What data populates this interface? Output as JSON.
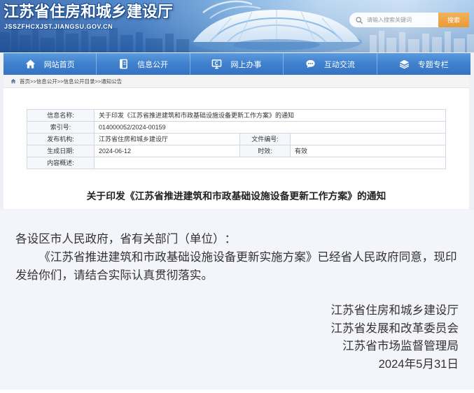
{
  "theme": {
    "brand_blue": "#3573c2",
    "brand_blue_light": "#5b9ade",
    "accent_orange": "#e99a36",
    "title_outline": "#1c4d93"
  },
  "header": {
    "site_title": "江苏省住房和城乡建设厅",
    "site_domain": "JSSZFHCXJST.JIANGSU.GOV.CN",
    "search": {
      "icon": "search-icon",
      "placeholder": "请输入搜索关键词",
      "button_label": "搜索"
    }
  },
  "nav": {
    "items": [
      {
        "label": "网站首页",
        "icon": "home-icon"
      },
      {
        "label": "信息公开",
        "icon": "notebook-icon"
      },
      {
        "label": "网上办事",
        "icon": "monitor-icon"
      },
      {
        "label": "互动交流",
        "icon": "chat-bubble-icon"
      },
      {
        "label": "专题专栏",
        "icon": "layers-icon"
      }
    ]
  },
  "breadcrumb": {
    "icon": "home-icon",
    "separator": ">>",
    "items": [
      "首页",
      "信息公开",
      "信息公开目录",
      "通知公告"
    ]
  },
  "info_table": {
    "title_label": "信息名称:",
    "title_value": "关于印发《江苏省推进建筑和市政基础设施设备更新工作方案》的通知",
    "index_label": "索引号:",
    "index_value": "014000052/2024-00159",
    "publisher_label": "发布机构:",
    "publisher_value": "江苏省住房和城乡建设厅",
    "doc_number_label": "文件编号:",
    "date_label": "生成日期:",
    "date_value": "2024-06-12",
    "validity_label": "时效:",
    "validity_value": "有效",
    "summary_label": "内容概述:"
  },
  "article": {
    "title": "关于印发《江苏省推进建筑和市政基础设施设备更新工作方案》的通知",
    "salutation": "各设区市人民政府，省有关部门（单位）：",
    "body": "《江苏省推进建筑和市政基础设施设备更新实施方案》已经省人民政府同意，现印发给你们，请结合实际认真贯彻落实。",
    "signatories": [
      "江苏省住房和城乡建设厅",
      "江苏省发展和改革委员会",
      "江苏省市场监督管理局"
    ],
    "date": "2024年5月31日"
  }
}
